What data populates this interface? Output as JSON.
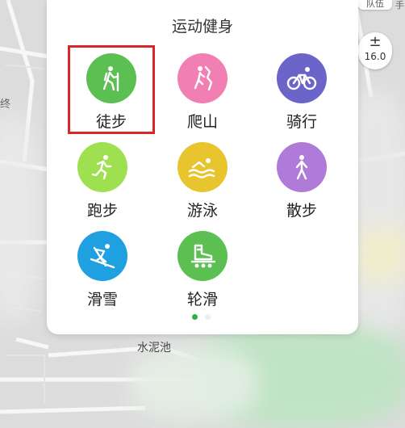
{
  "panel": {
    "title": "运动健身",
    "activities": [
      {
        "label": "徒步",
        "icon": "hiking-icon",
        "color": "#5cbf52",
        "selected": true
      },
      {
        "label": "爬山",
        "icon": "climbing-icon",
        "color": "#f27fb3"
      },
      {
        "label": "骑行",
        "icon": "bicycle-icon",
        "color": "#6b65c9"
      },
      {
        "label": "跑步",
        "icon": "running-icon",
        "color": "#9ee050"
      },
      {
        "label": "游泳",
        "icon": "swimming-icon",
        "color": "#e8c52e"
      },
      {
        "label": "散步",
        "icon": "walking-icon",
        "color": "#b07bd8"
      },
      {
        "label": "滑雪",
        "icon": "skiing-icon",
        "color": "#1fa0e0"
      },
      {
        "label": "轮滑",
        "icon": "roller-skate-icon",
        "color": "#5cbf52"
      }
    ],
    "page_indicator": {
      "current": 1,
      "total": 2
    },
    "highlight_color": "#d9262b"
  },
  "map": {
    "zoom_level": "16.0",
    "zoom_icon": "±",
    "label_road": "水泥池",
    "label_left": "终",
    "team_chip": "队伍",
    "edge_char": "手"
  }
}
